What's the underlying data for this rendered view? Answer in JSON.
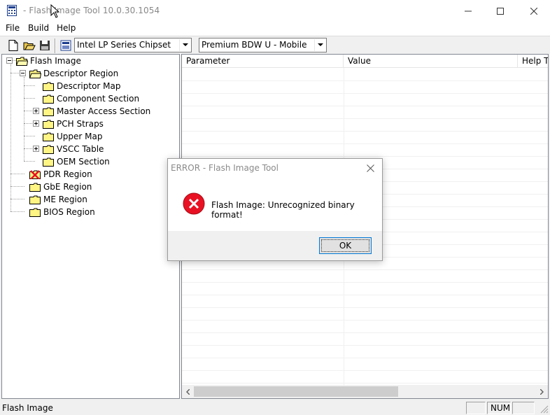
{
  "window": {
    "title": "- Flash Image Tool 10.0.30.1054",
    "app_icon": "calculator-app-icon"
  },
  "menu": [
    "File",
    "Build",
    "Help"
  ],
  "toolbar": {
    "chipset_value": "Intel LP Series Chipset",
    "sku_value": "Premium BDW U - Mobile"
  },
  "tree": {
    "root": "Flash Image",
    "descriptor_region": "Descriptor Region",
    "descriptor_children": [
      "Descriptor Map",
      "Component Section",
      "Master Access Section",
      "PCH Straps",
      "Upper Map",
      "VSCC Table",
      "OEM Section"
    ],
    "regions": [
      "PDR Region",
      "GbE Region",
      "ME Region",
      "BIOS Region"
    ]
  },
  "table": {
    "columns": [
      "Parameter",
      "Value",
      "Help Text"
    ]
  },
  "status": {
    "text": "Flash Image",
    "num": "NUM"
  },
  "dialog": {
    "title": "ERROR - Flash Image Tool",
    "message": "Flash Image: Unrecognized binary format!",
    "ok_label": "OK",
    "icon": "error-icon"
  },
  "colors": {
    "error_red": "#e81123",
    "folder_yellow": "#fff584",
    "focus_blue": "#0078d7"
  }
}
